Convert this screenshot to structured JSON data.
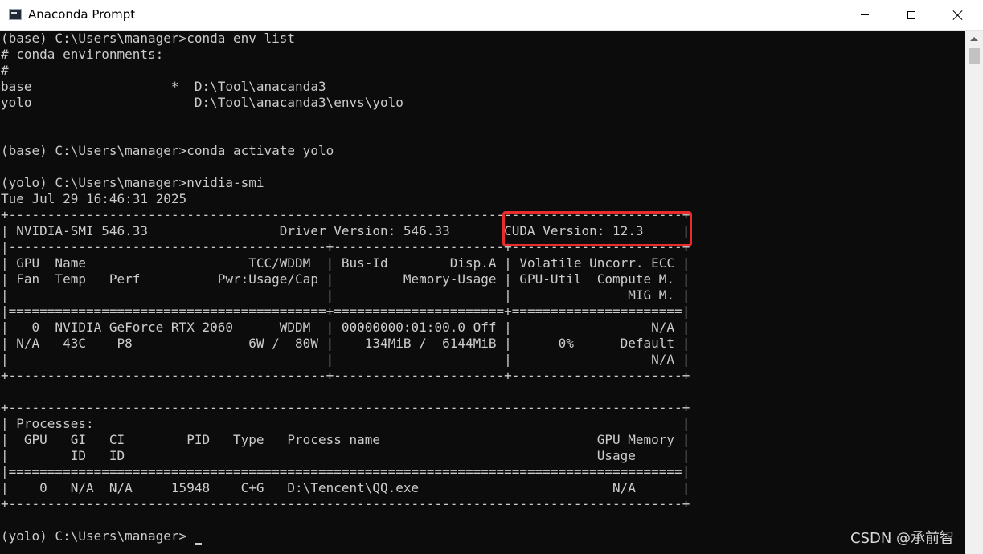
{
  "window": {
    "title": "Anaconda Prompt",
    "icon": "terminal-app-icon",
    "controls": [
      "minimize-icon",
      "maximize-icon",
      "close-icon"
    ]
  },
  "terminal": {
    "lines": [
      "(base) C:\\Users\\manager>conda env list",
      "# conda environments:",
      "#",
      "base                  *  D:\\Tool\\anacanda3",
      "yolo                     D:\\Tool\\anacanda3\\envs\\yolo",
      "",
      "",
      "(base) C:\\Users\\manager>conda activate yolo",
      "",
      "(yolo) C:\\Users\\manager>nvidia-smi",
      "Tue Jul 29 16:46:31 2025",
      "+---------------------------------------------------------------------------------------+",
      "| NVIDIA-SMI 546.33                 Driver Version: 546.33       CUDA Version: 12.3     |",
      "|-----------------------------------------+----------------------+----------------------+",
      "| GPU  Name                     TCC/WDDM  | Bus-Id        Disp.A | Volatile Uncorr. ECC |",
      "| Fan  Temp   Perf          Pwr:Usage/Cap |         Memory-Usage | GPU-Util  Compute M. |",
      "|                                         |                      |               MIG M. |",
      "|=========================================+======================+======================|",
      "|   0  NVIDIA GeForce RTX 2060      WDDM  | 00000000:01:00.0 Off |                  N/A |",
      "| N/A   43C    P8               6W /  80W |    134MiB /  6144MiB |      0%      Default |",
      "|                                         |                      |                  N/A |",
      "+-----------------------------------------+----------------------+----------------------+",
      "",
      "+---------------------------------------------------------------------------------------+",
      "| Processes:                                                                            |",
      "|  GPU   GI   CI        PID   Type   Process name                            GPU Memory |",
      "|        ID   ID                                                             Usage      |",
      "|=======================================================================================|",
      "|    0   N/A  N/A     15948    C+G   D:\\Tencent\\QQ.exe                         N/A      |",
      "+---------------------------------------------------------------------------------------+",
      "",
      "(yolo) C:\\Users\\manager>"
    ]
  },
  "annotation": {
    "highlight_color": "#e82c2c"
  },
  "watermark": "CSDN @承前智"
}
